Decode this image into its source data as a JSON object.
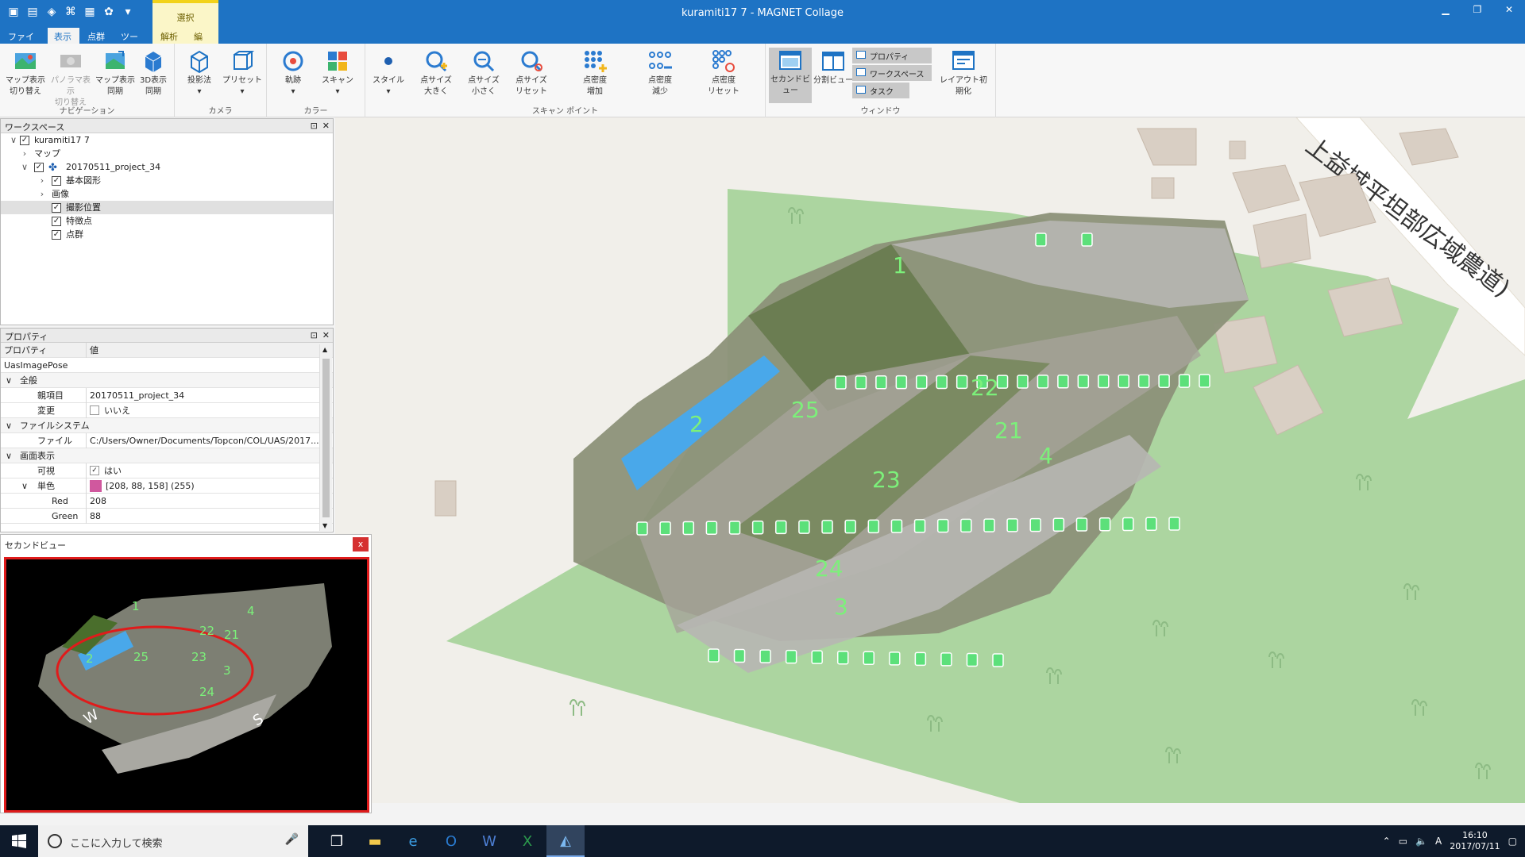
{
  "window": {
    "title": "kuramiti17 7 - MAGNET Collage",
    "context_tab_group": "選択"
  },
  "tabs": [
    {
      "label": "ファイル"
    },
    {
      "label": "表示"
    },
    {
      "label": "点群"
    },
    {
      "label": "ツール"
    },
    {
      "label": "解析"
    },
    {
      "label": "編集"
    }
  ],
  "ribbon": {
    "groups": [
      {
        "label": "ナビゲーション"
      },
      {
        "label": "カメラ"
      },
      {
        "label": "カラー"
      },
      {
        "label": "スキャン ポイント"
      },
      {
        "label": "ウィンドウ"
      }
    ],
    "buttons": {
      "map_toggle": "マップ表示\n切り替え",
      "pano_toggle": "パノラマ表示\n切り替え",
      "map_sync": "マップ表示\n同期",
      "view3d_sync": "3D表示\n同期",
      "projection": "投影法",
      "preset": "プリセット",
      "trajectory": "軌跡",
      "scan": "スキャン",
      "style": "スタイル",
      "pt_size_up": "点サイズ\n大きく",
      "pt_size_down": "点サイズ\n小さく",
      "pt_size_reset": "点サイズ\nリセット",
      "density_up": "点密度\n増加",
      "density_down": "点密度\n減少",
      "density_reset": "点密度\nリセット",
      "second_view": "セカンドビュー",
      "split_view": "分割ビュー",
      "props_small": "プロパティ",
      "workspace_small": "ワークスペース",
      "task_small": "タスク",
      "layout_reset": "レイアウト初期化"
    }
  },
  "workspace": {
    "title": "ワークスペース",
    "tree": [
      {
        "label": "kuramiti17 7"
      },
      {
        "label": "マップ"
      },
      {
        "label": "20170511_project_34"
      },
      {
        "label": "基本図形"
      },
      {
        "label": "画像"
      },
      {
        "label": "撮影位置"
      },
      {
        "label": "特徴点"
      },
      {
        "label": "点群"
      }
    ]
  },
  "properties": {
    "title": "プロパティ",
    "col_prop": "プロパティ",
    "col_value": "値",
    "type_name": "UasImagePose",
    "rows": [
      {
        "k": "全般",
        "v": ""
      },
      {
        "k": "親項目",
        "v": "20170511_project_34"
      },
      {
        "k": "変更",
        "v": "いいえ"
      },
      {
        "k": "ファイルシステム",
        "v": ""
      },
      {
        "k": "ファイル",
        "v": "C:/Users/Owner/Documents/Topcon/COL/UAS/2017..."
      },
      {
        "k": "画面表示",
        "v": ""
      },
      {
        "k": "可視",
        "v": "はい"
      },
      {
        "k": "単色",
        "v": "[208, 88, 158] (255)"
      },
      {
        "k": "Red",
        "v": "208"
      },
      {
        "k": "Green",
        "v": "88"
      }
    ],
    "swatch_color": "#d0589e"
  },
  "map": {
    "road_label": "上益城平坦部広域農道)",
    "point_labels": [
      "1",
      "2",
      "25",
      "22",
      "21",
      "4",
      "23",
      "24",
      "3"
    ],
    "marker_color": "#5ce07a",
    "label_color": "#7cf07a"
  },
  "second_view": {
    "title": "セカンドビュー",
    "close": "x",
    "point_labels": [
      "1",
      "4",
      "22",
      "21",
      "2",
      "25",
      "23",
      "3",
      "24"
    ],
    "compass": [
      "W",
      "S"
    ],
    "ellipse_color": "#e01b1b"
  },
  "taskbar": {
    "search_placeholder": "ここに入力して検索",
    "time": "16:10",
    "date": "2017/07/11",
    "ime": "A"
  }
}
